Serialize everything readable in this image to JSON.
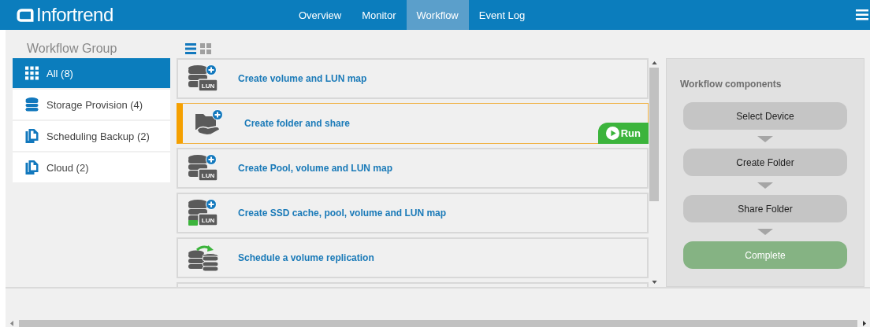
{
  "header": {
    "logo": "Infortrend",
    "nav": [
      {
        "label": "Overview",
        "selected": false
      },
      {
        "label": "Monitor",
        "selected": false
      },
      {
        "label": "Workflow",
        "selected": true
      },
      {
        "label": "Event Log",
        "selected": false
      }
    ]
  },
  "sidebar": {
    "title": "Workflow Group",
    "items": [
      {
        "label": "All (8)",
        "kind": "grid",
        "selected": true
      },
      {
        "label": "Storage Provision (4)",
        "kind": "database",
        "selected": false
      },
      {
        "label": "Scheduling Backup (2)",
        "kind": "copy",
        "selected": false
      },
      {
        "label": "Cloud (2)",
        "kind": "copy",
        "selected": false
      }
    ]
  },
  "view_modes": [
    {
      "kind": "list",
      "selected": true
    },
    {
      "kind": "grid",
      "selected": false
    }
  ],
  "workflows": [
    {
      "title": "Create volume and LUN map",
      "kind": "lun",
      "badge": "LUN",
      "selected": false
    },
    {
      "title": "Create folder and share",
      "kind": "folder",
      "selected": true
    },
    {
      "title": "Create Pool, volume and LUN map",
      "kind": "lun",
      "badge": "LUN",
      "selected": false
    },
    {
      "title": "Create SSD cache, pool, volume and LUN map",
      "kind": "ssd",
      "badge": "LUN",
      "selected": false
    },
    {
      "title": "Schedule a volume replication",
      "kind": "replicate",
      "selected": false
    }
  ],
  "run_button": {
    "label": "Run"
  },
  "components": {
    "title": "Workflow components",
    "steps": [
      {
        "label": "Select Device",
        "kind": "step"
      },
      {
        "label": "Create Folder",
        "kind": "step"
      },
      {
        "label": "Share Folder",
        "kind": "step"
      },
      {
        "label": "Complete",
        "kind": "complete"
      }
    ]
  }
}
